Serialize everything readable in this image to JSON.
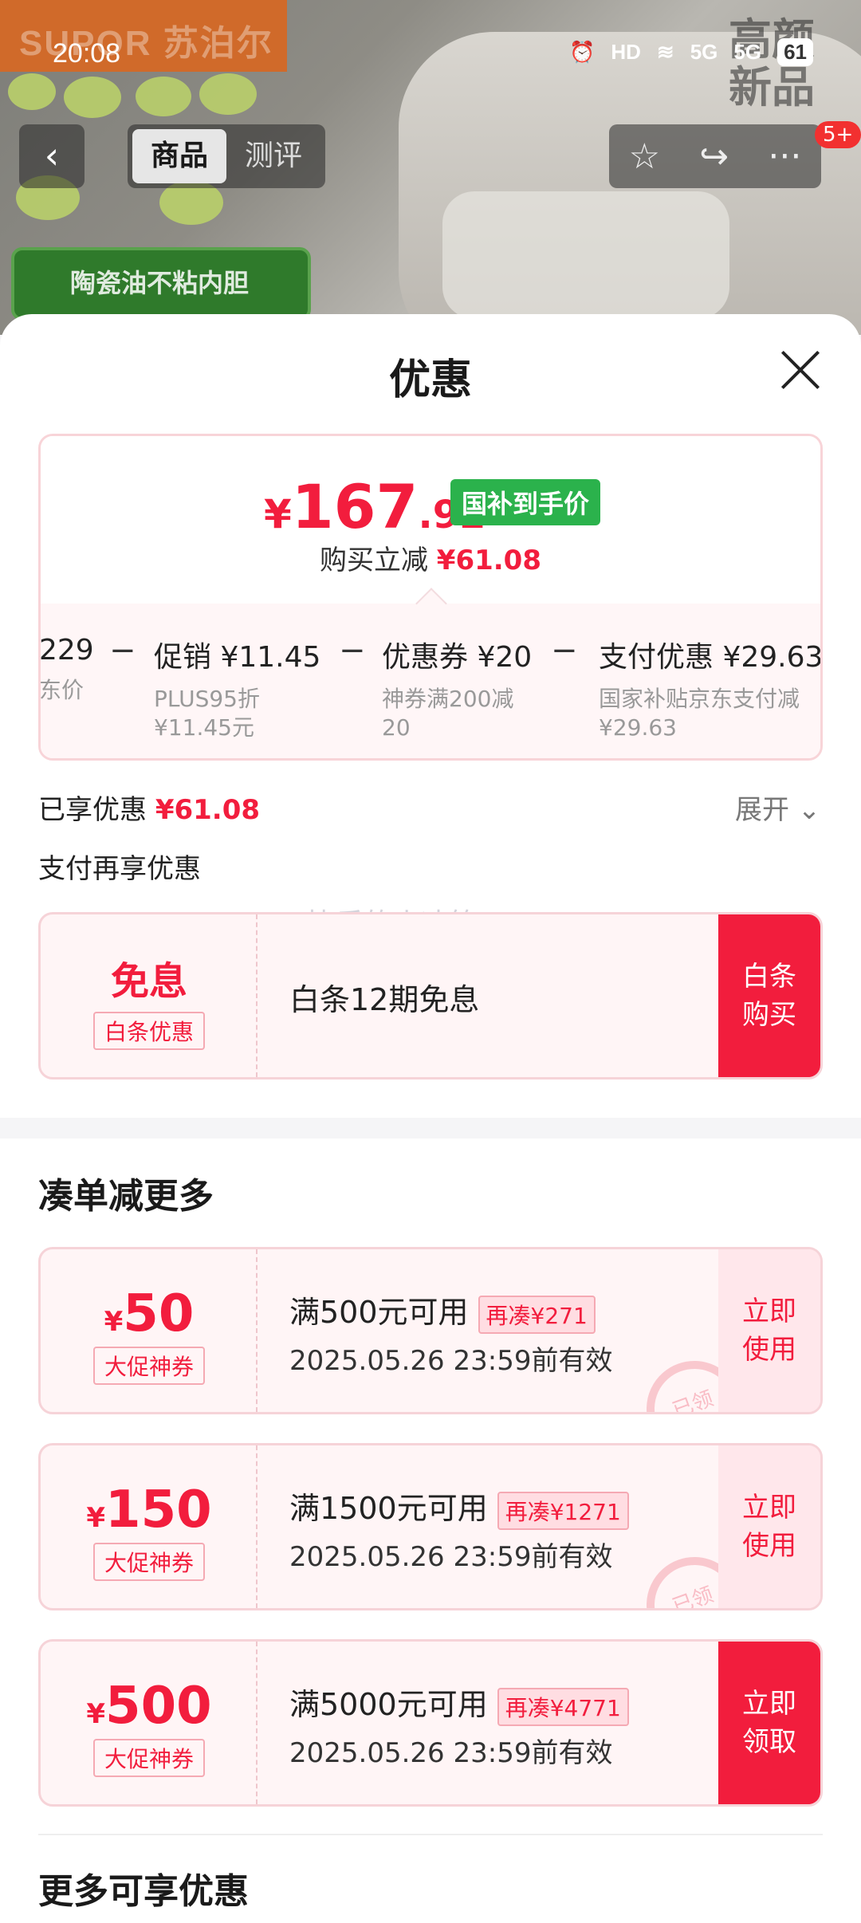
{
  "status_bar": {
    "time": "20:08",
    "network": "HD",
    "signal1": "5G",
    "signal2": "5G",
    "battery": "61"
  },
  "hero": {
    "brand_text": "SUPOR 苏泊尔",
    "badge_text": "陶瓷油不粘内胆",
    "new_tag": "高颜新品"
  },
  "nav": {
    "back_icon": "‹",
    "tabs": [
      "商品",
      "测评"
    ],
    "actions": [
      "☆",
      "↪",
      "···"
    ],
    "message_badge": "5+"
  },
  "sheet": {
    "title": "优惠",
    "price": {
      "yen": "¥",
      "int": "167",
      "dec": ".92",
      "tag": "国补到手价",
      "reduce_label": "购买立减",
      "reduce_value": "¥61.08"
    },
    "breakdown": [
      {
        "head": "229",
        "sub1": "东价",
        "sub2": ""
      },
      {
        "head": "促销 ¥11.45",
        "sub1": "PLUS95折",
        "sub2": "¥11.45元"
      },
      {
        "head": "优惠券 ¥20",
        "sub1": "神券满200减",
        "sub2": "20"
      },
      {
        "head": "支付优惠 ¥29.63",
        "sub1": "国家补贴京东支付减",
        "sub2": "¥29.63"
      }
    ],
    "minus": "−",
    "enjoyed_label": "已享优惠",
    "enjoyed_value": "¥61.08",
    "expand_label": "展开 ⌄",
    "pay_tip": "支付再享优惠",
    "watermark": "快乐的小冰箱",
    "baitiao": {
      "amount": "免息",
      "tag": "白条优惠",
      "desc": "白条12期免息",
      "button": "白条购买"
    },
    "section1_title": "凑单减更多",
    "coupons": [
      {
        "yen": "¥",
        "amount": "50",
        "tag": "大促神券",
        "cond": "满500元可用",
        "more": "再凑¥271",
        "valid": "2025.05.26 23:59前有效",
        "button": "立即使用",
        "claimed": true,
        "stamp": "已领"
      },
      {
        "yen": "¥",
        "amount": "150",
        "tag": "大促神券",
        "cond": "满1500元可用",
        "more": "再凑¥1271",
        "valid": "2025.05.26 23:59前有效",
        "button": "立即使用",
        "claimed": true,
        "stamp": "已领"
      },
      {
        "yen": "¥",
        "amount": "500",
        "tag": "大促神券",
        "cond": "满5000元可用",
        "more": "再凑¥4771",
        "valid": "2025.05.26 23:59前有效",
        "button": "立即领取",
        "claimed": false,
        "stamp": ""
      }
    ],
    "section2_title": "更多可享优惠",
    "colors": {
      "accent": "#f21d3d",
      "green": "#2bb24c"
    }
  }
}
